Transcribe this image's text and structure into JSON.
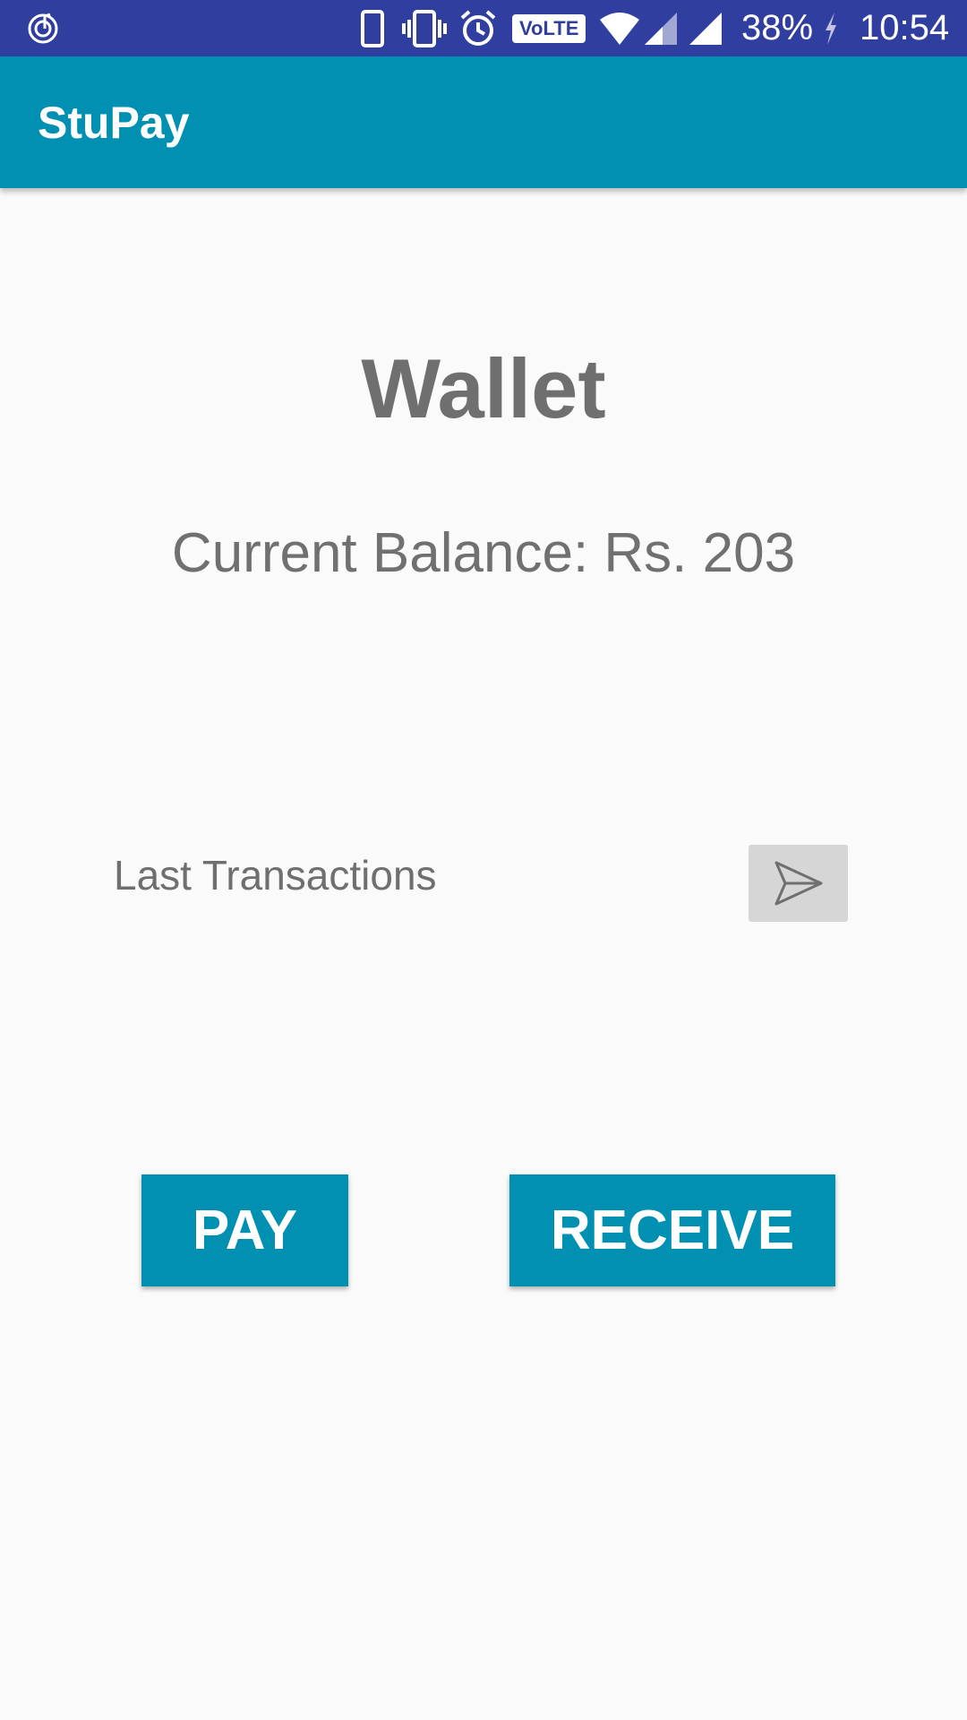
{
  "status_bar": {
    "battery": "38%",
    "time": "10:54",
    "network_badge": "VoLTE",
    "icons": [
      "music-app-icon",
      "phone-icon",
      "vibrate-icon",
      "alarm-icon",
      "volte-icon",
      "wifi-icon",
      "signal-icon",
      "signal-icon",
      "charging-icon"
    ]
  },
  "app_bar": {
    "title": "StuPay",
    "color": "#0190b1"
  },
  "wallet": {
    "title": "Wallet",
    "balance_text": "Current Balance: Rs. 203",
    "last_transactions_label": "Last Transactions",
    "send_icon": "send-icon"
  },
  "actions": {
    "pay_label": "PAY",
    "receive_label": "RECEIVE",
    "button_color": "#0190b1"
  }
}
